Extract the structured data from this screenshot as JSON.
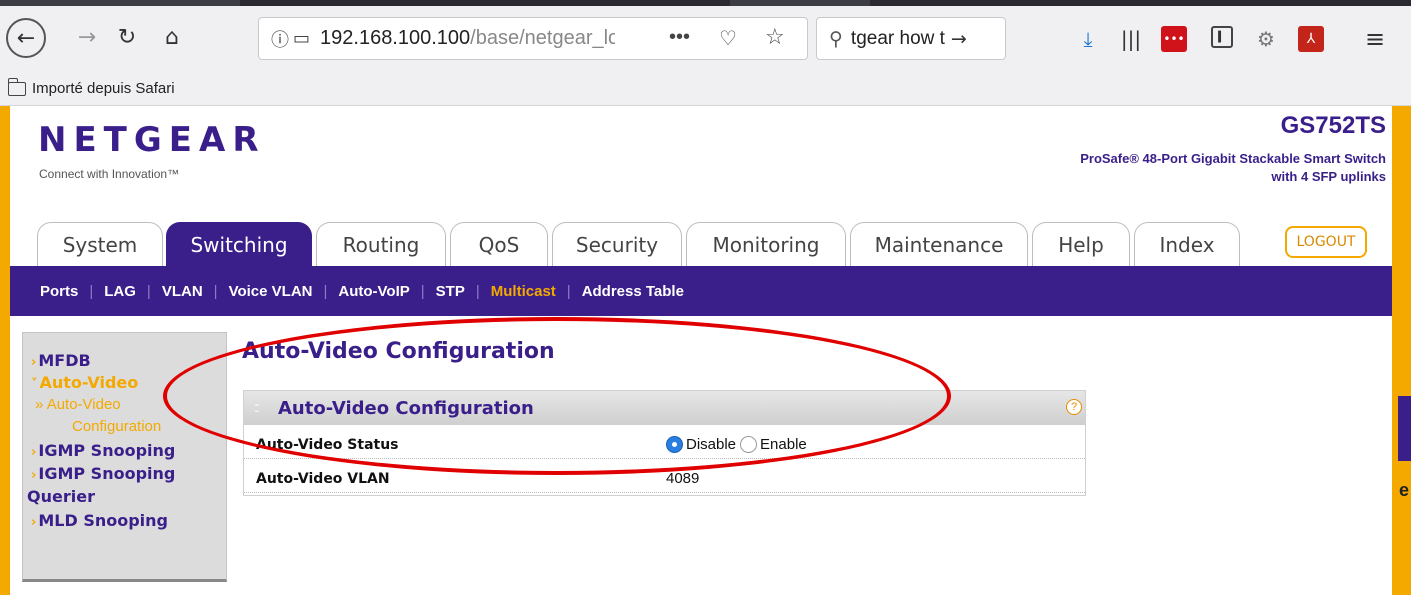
{
  "browser": {
    "url_host": "192.168.100.100",
    "url_path": "/base/netgear_lo",
    "search_text": "tgear how t",
    "bookmark": "Importé depuis Safari"
  },
  "header": {
    "brand": "NETGEAR",
    "tagline": "Connect with Innovation™",
    "model": "GS752TS",
    "model_desc_line1": "ProSafe® 48-Port Gigabit Stackable Smart Switch",
    "model_desc_line2": "with 4 SFP uplinks",
    "logout": "LOGOUT"
  },
  "tabs": [
    "System",
    "Switching",
    "Routing",
    "QoS",
    "Security",
    "Monitoring",
    "Maintenance",
    "Help",
    "Index"
  ],
  "subnav": [
    "Ports",
    "LAG",
    "VLAN",
    "Voice VLAN",
    "Auto-VoIP",
    "STP",
    "Multicast",
    "Address Table"
  ],
  "sidebar": {
    "mfdb": "MFDB",
    "auto_video": "Auto-Video",
    "auto_video_config_1": "Auto-Video",
    "auto_video_config_2": "Configuration",
    "igmp": "IGMP Snooping",
    "igmp_querier_1": "IGMP Snooping",
    "igmp_querier_2": "Querier",
    "mld": "MLD Snooping"
  },
  "main": {
    "title": "Auto-Video Configuration",
    "panel_title": "Auto-Video Configuration",
    "help": "?",
    "status_label": "Auto-Video Status",
    "disable": "Disable",
    "enable": "Enable",
    "status_selected": "Disable",
    "vlan_label": "Auto-Video VLAN",
    "vlan_value": "4089"
  },
  "colors": {
    "brand_purple": "#3a1f8a",
    "accent_orange": "#f3a900",
    "annotation_red": "#e00000"
  }
}
